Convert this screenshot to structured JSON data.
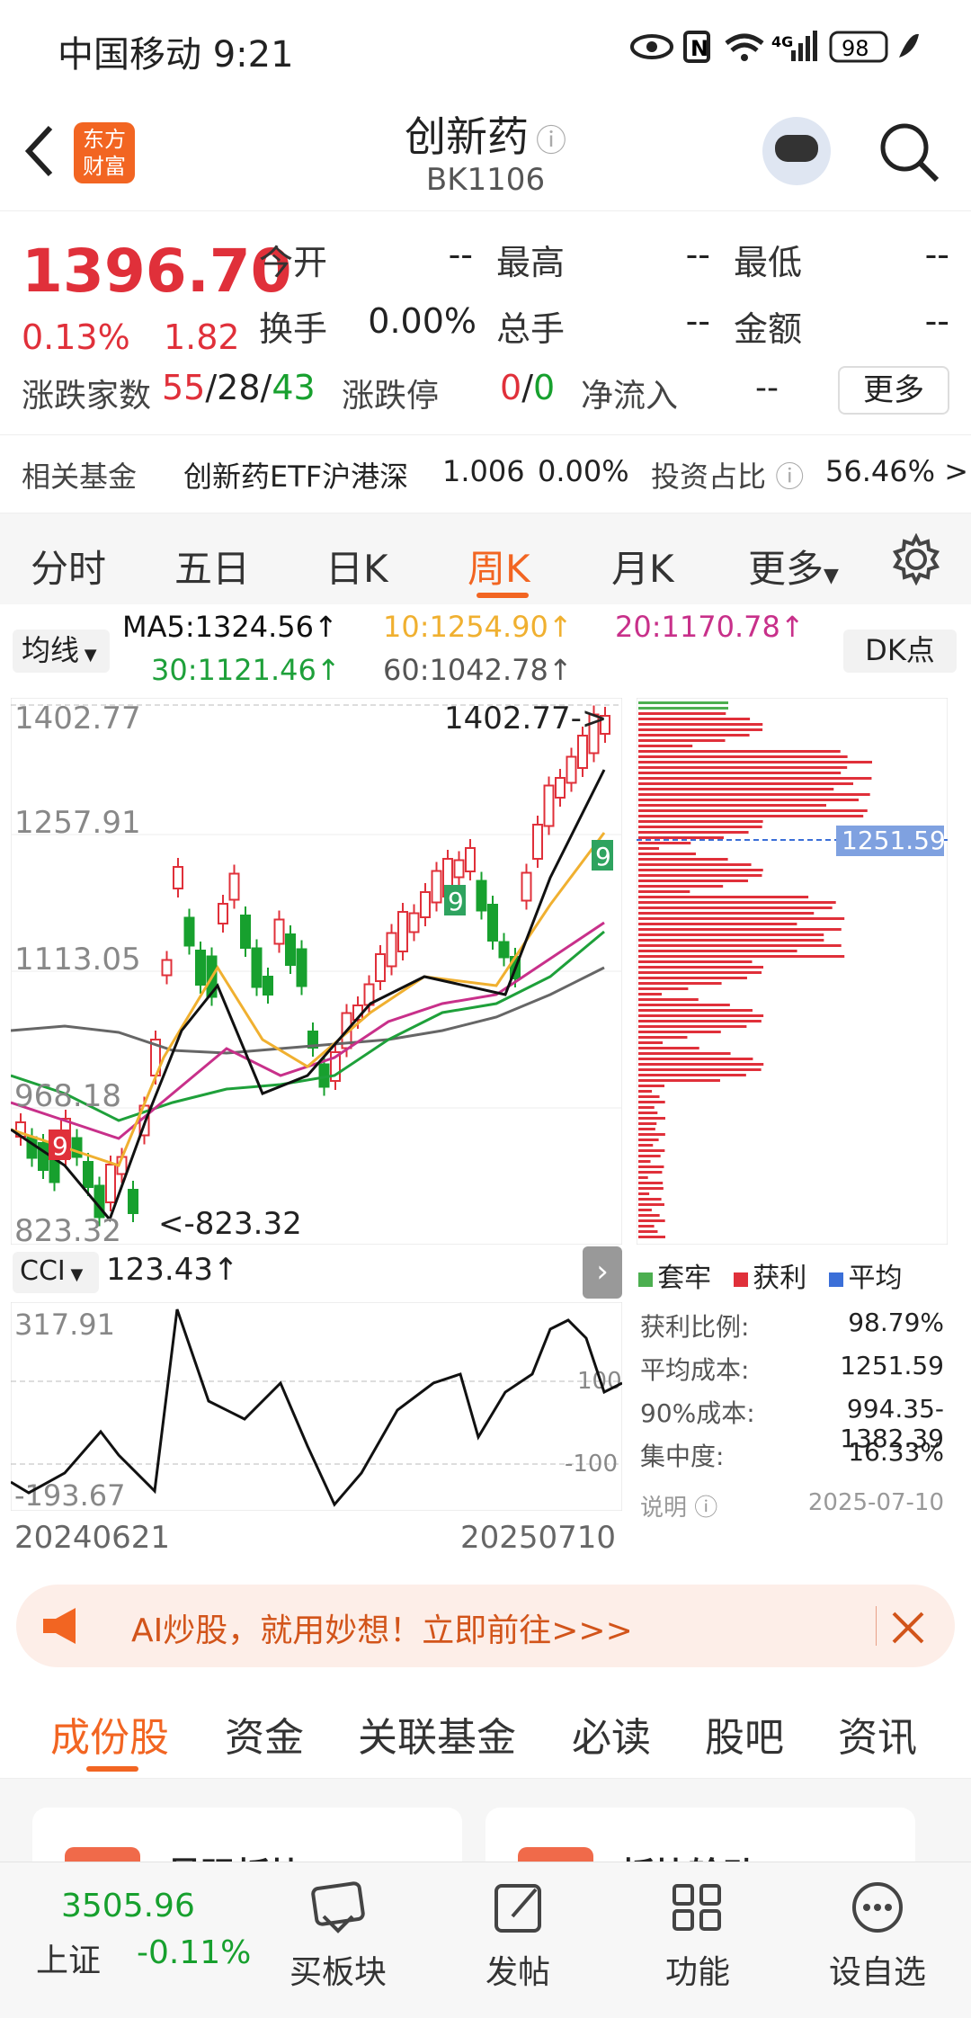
{
  "status": {
    "carrier_time": "中国移动 9:21",
    "battery": "98",
    "signal_label": "4G"
  },
  "header": {
    "title": "创新药",
    "code": "BK1106",
    "logo_text": "东方财富"
  },
  "quote": {
    "price": "1396.70",
    "pct": "0.13%",
    "chg": "1.82",
    "stats": [
      {
        "label": "今开",
        "value": "--"
      },
      {
        "label": "最高",
        "value": "--"
      },
      {
        "label": "最低",
        "value": "--"
      },
      {
        "label": "换手",
        "value": "0.00%"
      },
      {
        "label": "总手",
        "value": "--"
      },
      {
        "label": "金额",
        "value": "--"
      }
    ],
    "breadth_label": "涨跌家数",
    "up": "55",
    "flat": "28",
    "down": "43",
    "limit_label": "涨跌停",
    "limit_up": "0",
    "limit_down": "0",
    "flow_label": "净流入",
    "flow_value": "--",
    "more_button": "更多",
    "fund_label": "相关基金",
    "fund_name": "创新药ETF沪港深",
    "fund_price": "1.006",
    "fund_pct": "0.00%",
    "ratio_label": "投资占比",
    "ratio_value": "56.46% >"
  },
  "tabs": [
    "分时",
    "五日",
    "日K",
    "周K",
    "月K",
    "更多"
  ],
  "active_tab": "周K",
  "ma": {
    "select": "均线",
    "ma5": "MA5:1324.56↑",
    "ma10": "10:1254.90↑",
    "ma20": "20:1170.78↑",
    "ma30": "30:1121.46↑",
    "ma60": "60:1042.78↑",
    "dk": "DK点"
  },
  "colors": {
    "up": "#e0303a",
    "down": "#17a02e",
    "accent": "#f26522",
    "ma5": "#111111",
    "ma10": "#f0b030",
    "ma20": "#c8308a",
    "ma30": "#1ea03a",
    "ma60": "#666666"
  },
  "kline": {
    "y_labels": [
      "1402.77",
      "1257.91",
      "1113.05",
      "968.18",
      "823.32"
    ],
    "max_label": "1402.77->",
    "min_label": "<-823.32",
    "ylim": [
      823.32,
      1402.77
    ]
  },
  "chip": {
    "cost_label": "1251.59",
    "legend": [
      "套牢",
      "获利",
      "平均"
    ],
    "rows": [
      {
        "k": "获利比例:",
        "v": "98.79%"
      },
      {
        "k": "平均成本:",
        "v": "1251.59"
      },
      {
        "k": "90%成本:",
        "v": "994.35-1382.39"
      },
      {
        "k": "集中度:",
        "v": "16.33%"
      }
    ],
    "note": "说明",
    "date": "2025-07-10"
  },
  "cci": {
    "select": "CCI",
    "value": "123.43↑",
    "top": "317.91",
    "bottom": "-193.67",
    "l100": "100",
    "lm100": "-100",
    "start": "20240621",
    "end": "20250710"
  },
  "banner": {
    "text": "AI炒股，就用妙想！立即前往>>>"
  },
  "bottom_tabs": [
    "成份股",
    "资金",
    "关联基金",
    "必读",
    "股吧",
    "资讯"
  ],
  "cards": [
    "最强板块",
    "板块轮动"
  ],
  "nav": {
    "index_value": "3505.96",
    "index_name": "上证",
    "index_pct": "-0.11%",
    "items": [
      "买板块",
      "发帖",
      "功能",
      "设自选"
    ]
  }
}
